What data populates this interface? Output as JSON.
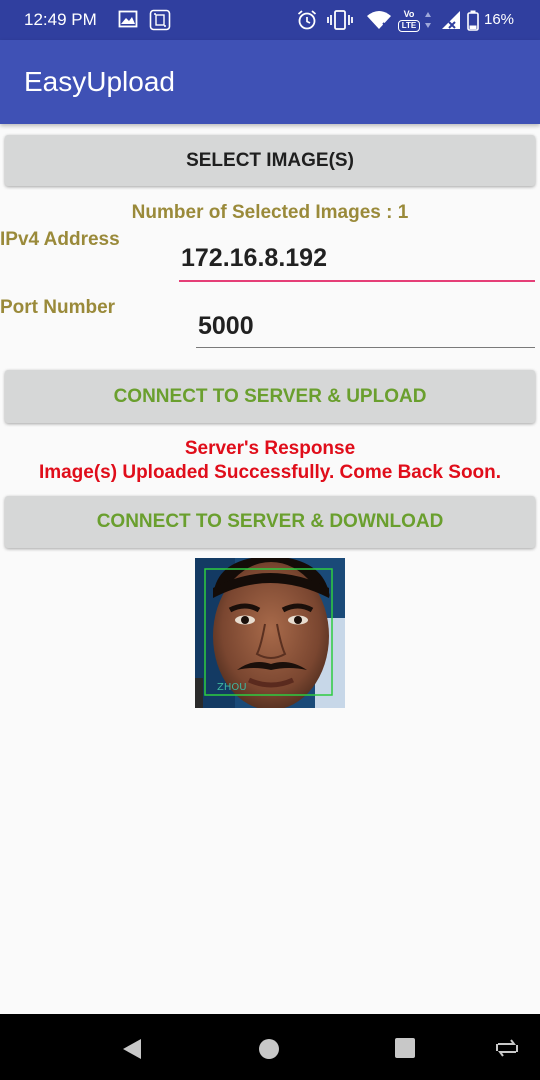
{
  "status_bar": {
    "time": "12:49 PM",
    "battery": "16%",
    "network_badge_line1": "Vo",
    "network_badge_line2": "LTE"
  },
  "app_bar": {
    "title": "EasyUpload"
  },
  "select_button_label": "SELECT IMAGE(S)",
  "selected_count_text": "Number of Selected Images : 1",
  "ipv4": {
    "label": "IPv4 Address",
    "value": "172.16.8.192"
  },
  "port": {
    "label": "Port Number",
    "value": "5000"
  },
  "upload_button_label": "CONNECT TO SERVER & UPLOAD",
  "server_response": {
    "title": "Server's Response",
    "message": "Image(s) Uploaded Successfully. Come Back Soon."
  },
  "download_button_label": "CONNECT TO SERVER & DOWNLOAD",
  "preview_image": {
    "caption": "ZHOU"
  },
  "colors": {
    "status_bar": "#303f9f",
    "app_bar": "#3f51b5",
    "accent_pink": "#e53e77",
    "button_text_green": "#6a9f2e",
    "label_olive": "#9a8a3a",
    "response_red": "#e00d1a",
    "detection_box": "#2ecc40"
  }
}
